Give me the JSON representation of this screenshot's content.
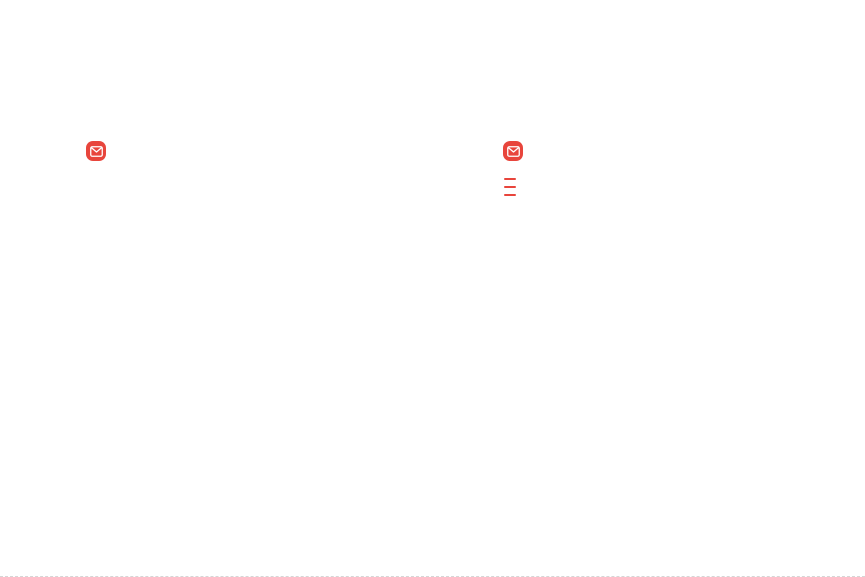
{
  "colors": {
    "email_icon_bg": "#e8453c",
    "email_icon_glyph": "#ffffff",
    "menu_icon": "#e8453c",
    "footer_rule": "#d6d6d6"
  },
  "left_column": {
    "email_icon": {
      "icon": "email-app-icon"
    }
  },
  "right_column": {
    "email_icon": {
      "icon": "email-app-icon"
    },
    "menu_icon": {
      "icon": "menu-icon"
    }
  }
}
